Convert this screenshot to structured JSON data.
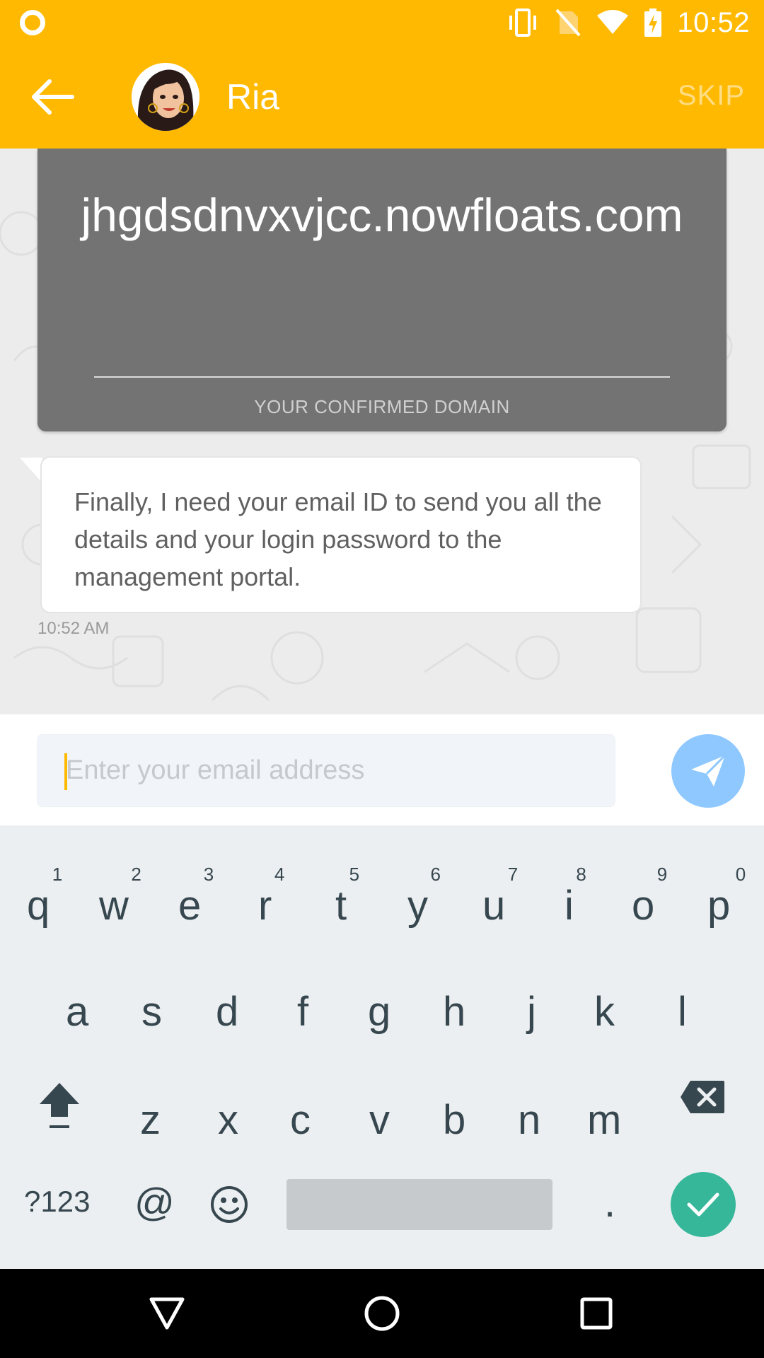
{
  "status_bar": {
    "time": "10:52"
  },
  "header": {
    "contact_name": "Ria",
    "skip_label": "SKIP"
  },
  "domain_card": {
    "domain": "jhgdsdnvxvjcc.nowfloats.com",
    "caption": "YOUR CONFIRMED DOMAIN"
  },
  "message": {
    "text": "Finally, I need your email ID to send you all the details and your login password to the management portal.",
    "time": "10:52 AM"
  },
  "input": {
    "placeholder": "Enter your email address"
  },
  "keyboard": {
    "row1": [
      {
        "key": "q",
        "hint": "1"
      },
      {
        "key": "w",
        "hint": "2"
      },
      {
        "key": "e",
        "hint": "3"
      },
      {
        "key": "r",
        "hint": "4"
      },
      {
        "key": "t",
        "hint": "5"
      },
      {
        "key": "y",
        "hint": "6"
      },
      {
        "key": "u",
        "hint": "7"
      },
      {
        "key": "i",
        "hint": "8"
      },
      {
        "key": "o",
        "hint": "9"
      },
      {
        "key": "p",
        "hint": "0"
      }
    ],
    "row2": [
      "a",
      "s",
      "d",
      "f",
      "g",
      "h",
      "j",
      "k",
      "l"
    ],
    "row3": [
      "z",
      "x",
      "c",
      "v",
      "b",
      "n",
      "m"
    ],
    "symbols_label": "?123",
    "at_label": "@",
    "period_label": "."
  },
  "colors": {
    "accent": "#FFB900",
    "send_button": "#8ec8ff",
    "enter_key": "#36b79a",
    "domain_card": "#737373"
  },
  "icons": [
    "back-arrow-icon",
    "send-icon",
    "shift-icon",
    "backspace-icon",
    "emoji-icon",
    "check-icon",
    "nav-back-icon",
    "nav-home-icon",
    "nav-recents-icon"
  ]
}
